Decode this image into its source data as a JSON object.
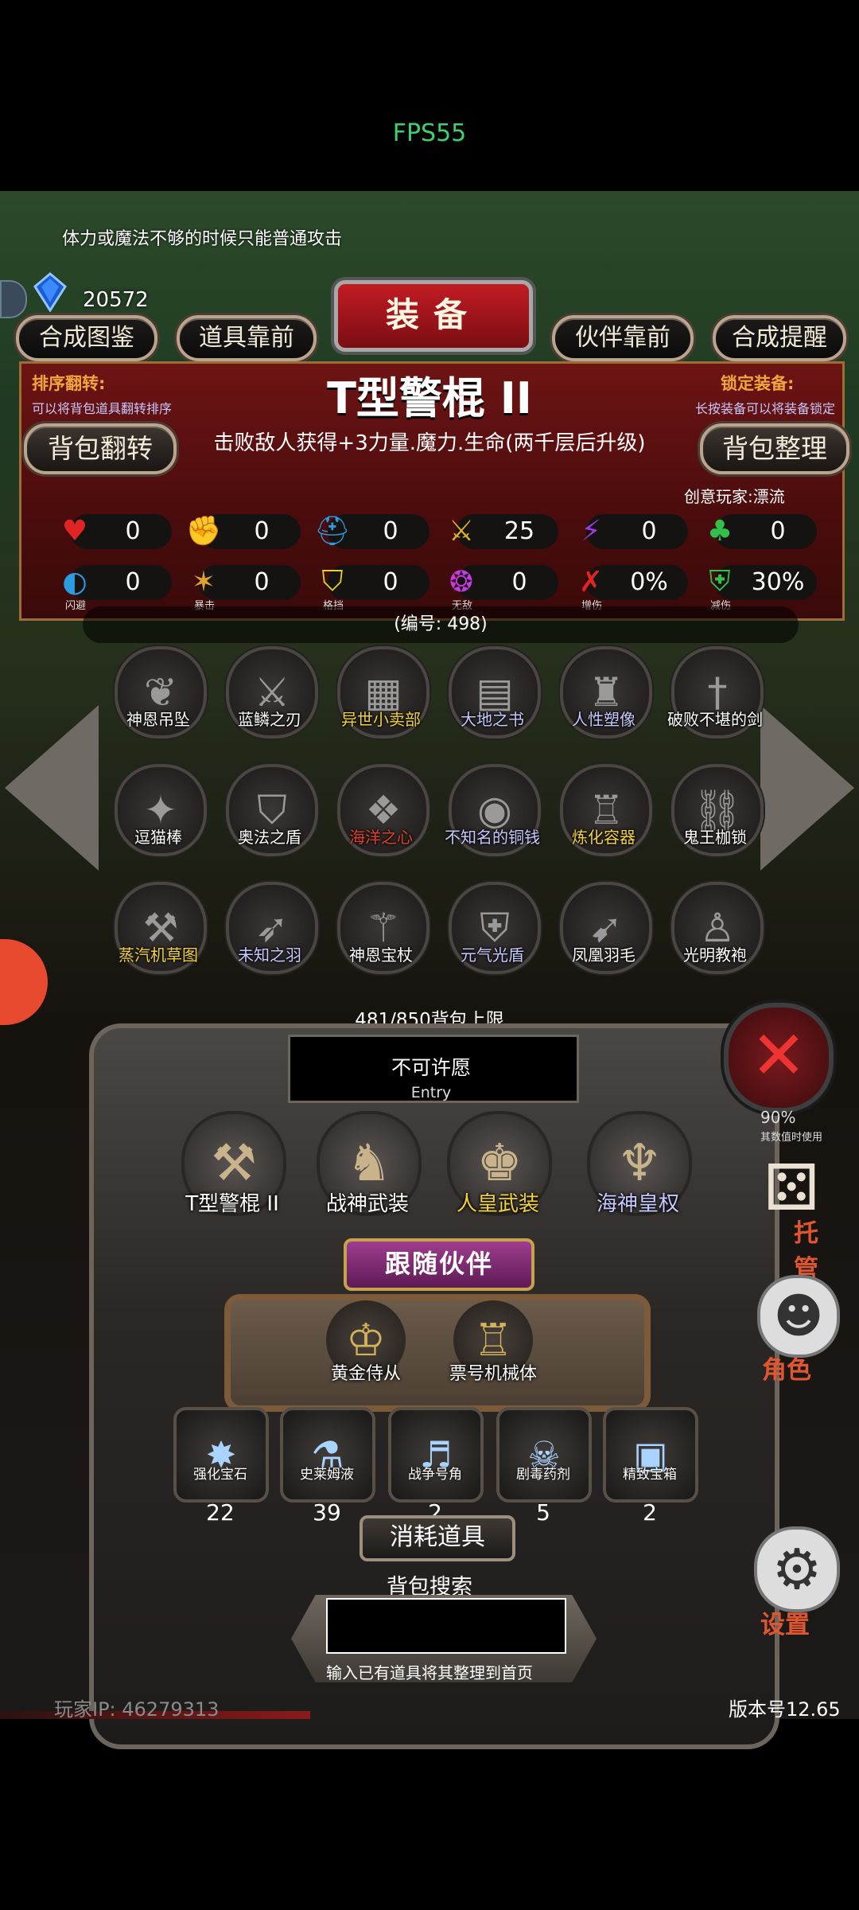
{
  "fps": "FPS55",
  "hint": "体力或魔法不够的时候只能普通攻击",
  "currency": {
    "amount": "20572",
    "icon": "blue-gem-icon"
  },
  "top_buttons": {
    "atlas": "合成图鉴",
    "items_front": "道具靠前",
    "partner_front": "伙伴靠前",
    "craft_tip": "合成提醒"
  },
  "header_title": "装备",
  "sort": {
    "title": "排序翻转:",
    "desc": "可以将背包道具翻转排序"
  },
  "lock": {
    "title": "锁定装备:",
    "desc": "长按装备可以将装备锁定"
  },
  "item": {
    "name": "T型警棍 II",
    "description": "击败敌人获得+3力量.魔力.生命(两千层后升级)",
    "creator": "创意玩家:漂流",
    "serial": "(编号: 498)"
  },
  "buttons": {
    "flip": "背包翻转",
    "sort": "背包整理"
  },
  "stats_row1": [
    {
      "icon": "heart-icon",
      "value": "0",
      "color": "#e02424"
    },
    {
      "icon": "strength-icon",
      "value": "0",
      "color": "#e0b327"
    },
    {
      "icon": "helmet-icon",
      "value": "0",
      "color": "#2d9be0"
    },
    {
      "icon": "sword-icon",
      "value": "25",
      "color": "#e0b327"
    },
    {
      "icon": "lightning-icon",
      "value": "0",
      "color": "#9c3be0"
    },
    {
      "icon": "clover-icon",
      "value": "0",
      "color": "#33c04a"
    }
  ],
  "stats_row2": [
    {
      "icon": "dodge-icon",
      "value": "0",
      "caption": "闪避",
      "color": "#2d9be0"
    },
    {
      "icon": "crit-icon",
      "value": "0",
      "caption": "暴击",
      "color": "#e0a22b"
    },
    {
      "icon": "block-icon",
      "value": "0",
      "caption": "格挡",
      "color": "#e0d22b"
    },
    {
      "icon": "invincible-icon",
      "value": "0",
      "caption": "无敌",
      "color": "#c43be0"
    },
    {
      "icon": "damage-up-icon",
      "value": "0%",
      "caption": "增伤",
      "color": "#e02424"
    },
    {
      "icon": "damage-down-icon",
      "value": "30%",
      "caption": "减伤",
      "color": "#33c04a"
    }
  ],
  "inventory": [
    {
      "label": "神恩吊坠",
      "color": "#ffffff",
      "icon": "pendant-icon"
    },
    {
      "label": "蓝鳞之刃",
      "color": "#ffffff",
      "icon": "blade-icon"
    },
    {
      "label": "异世小卖部",
      "color": "#f2d23b",
      "icon": "shop-icon"
    },
    {
      "label": "大地之书",
      "color": "#c6c8ff",
      "icon": "book-icon"
    },
    {
      "label": "人性塑像",
      "color": "#c6c8ff",
      "icon": "statue-icon"
    },
    {
      "label": "破败不堪的剑",
      "color": "#ffffff",
      "icon": "broken-sword-icon"
    },
    {
      "label": "逗猫棒",
      "color": "#ffffff",
      "icon": "cat-wand-icon"
    },
    {
      "label": "奥法之盾",
      "color": "#ffffff",
      "icon": "shield-icon"
    },
    {
      "label": "海洋之心",
      "color": "#e0402b",
      "icon": "ocean-heart-icon"
    },
    {
      "label": "不知名的铜钱",
      "color": "#c6c8ff",
      "icon": "coin-icon"
    },
    {
      "label": "炼化容器",
      "color": "#f2d23b",
      "icon": "furnace-icon"
    },
    {
      "label": "鬼王枷锁",
      "color": "#ffffff",
      "icon": "shackle-icon"
    },
    {
      "label": "蒸汽机草图",
      "color": "#f2d23b",
      "icon": "blueprint-icon"
    },
    {
      "label": "未知之羽",
      "color": "#c6c8ff",
      "icon": "feather-icon"
    },
    {
      "label": "神恩宝杖",
      "color": "#ffffff",
      "icon": "staff-icon"
    },
    {
      "label": "元气光盾",
      "color": "#c6c8ff",
      "icon": "light-shield-icon"
    },
    {
      "label": "凤凰羽毛",
      "color": "#ffffff",
      "icon": "phoenix-feather-icon"
    },
    {
      "label": "光明教袍",
      "color": "#ffffff",
      "icon": "robe-icon"
    }
  ],
  "capacity": "481/850背包上限",
  "wish": {
    "title": "不可许愿",
    "sub": "Entry"
  },
  "equipped": [
    {
      "label": "T型警棍 II",
      "color": "#ffffff",
      "icon": "baton-icon"
    },
    {
      "label": "战神武装",
      "color": "#ffffff",
      "icon": "war-god-icon"
    },
    {
      "label": "人皇武装",
      "color": "#f2d23b",
      "icon": "human-emperor-icon"
    },
    {
      "label": "海神皇权",
      "color": "#c6c8ff",
      "icon": "sea-god-scepter-icon"
    }
  ],
  "companion_title": "跟随伙伴",
  "companions": [
    {
      "label": "黄金侍从",
      "icon": "golden-squire-icon"
    },
    {
      "label": "票号机械体",
      "icon": "mech-body-icon"
    }
  ],
  "consumables": [
    {
      "label": "强化宝石",
      "count": "22",
      "icon": "green-gem-icon"
    },
    {
      "label": "史莱姆液",
      "count": "39",
      "icon": "slime-potion-icon"
    },
    {
      "label": "战争号角",
      "count": "2",
      "icon": "war-horn-icon"
    },
    {
      "label": "剧毒药剂",
      "count": "5",
      "icon": "poison-potion-icon"
    },
    {
      "label": "精致宝箱",
      "count": "2",
      "icon": "chest-icon"
    }
  ],
  "consumables_title": "消耗道具",
  "search": {
    "title": "背包搜索",
    "hint": "输入已有道具将其整理到首页",
    "value": ""
  },
  "side": {
    "dice_label": "托管",
    "role_label": "角色",
    "settings_label": "设置",
    "pct_partial": "90%",
    "pct_sub": "其数值时使用"
  },
  "footer": {
    "player_ip": "玩家IP: 46279313",
    "version": "版本号12.65"
  }
}
